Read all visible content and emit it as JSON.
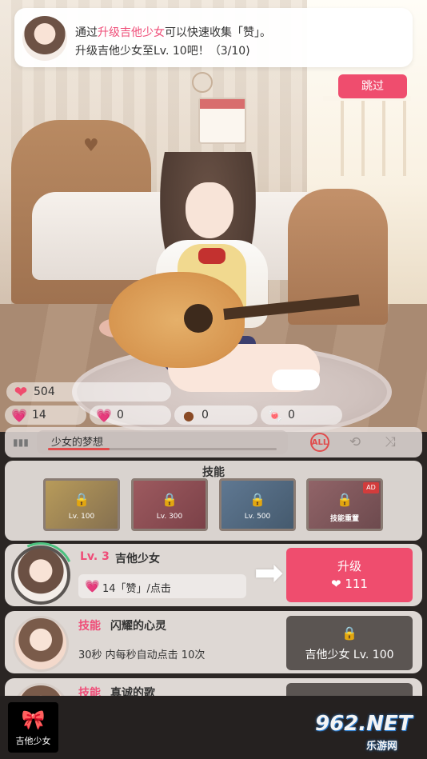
{
  "notification": {
    "text_before": "通过",
    "highlight": "升级吉他少女",
    "text_after": "可以快速收集「赞」。",
    "line2": "升级吉他少女至Lv. 10吧！（3/10)"
  },
  "skip_button": "跳过",
  "stats": {
    "likes_total": "504",
    "stat_a": "14",
    "stat_b": "0",
    "stat_c": "0",
    "stat_d": "0"
  },
  "music": {
    "song_title": "少女的梦想",
    "progress": 0.27,
    "mode_label": "ALL"
  },
  "skills": {
    "title": "技能",
    "cards": [
      {
        "label": "Lv. 100"
      },
      {
        "label": "Lv. 300"
      },
      {
        "label": "Lv. 500"
      },
      {
        "label": "技能重置",
        "ad": "AD"
      }
    ]
  },
  "character": {
    "level": "Lv. 3",
    "name": "吉他少女",
    "rate": "14「赞」/点击",
    "upgrade_label": "升级",
    "upgrade_cost": "111"
  },
  "skill_rows": [
    {
      "tag": "技能",
      "name": "闪耀的心灵",
      "desc": "30秒 内每秒自动点击 10次",
      "requirement": "吉他少女 Lv. 100"
    },
    {
      "tag": "技能",
      "name": "真诚的歌"
    }
  ],
  "bottom_tab": {
    "label": "吉他少女"
  },
  "watermark": {
    "big": "962.NET",
    "small": "乐游网"
  },
  "colors": {
    "accent": "#ef4d6e",
    "level": "#ef4d78",
    "locked": "#5b5552"
  }
}
